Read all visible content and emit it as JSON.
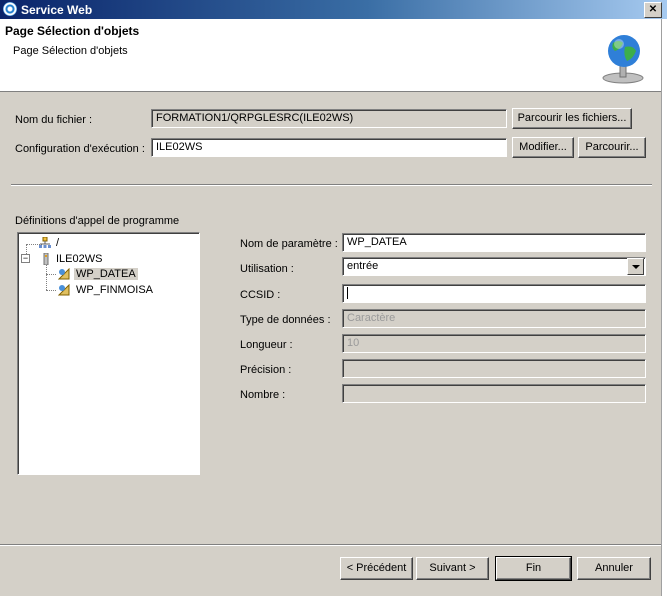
{
  "window": {
    "title": "Service Web"
  },
  "header": {
    "title": "Page Sélection d'objets",
    "subtitle": "Page Sélection d'objets"
  },
  "file": {
    "label": "Nom du fichier :",
    "value": "FORMATION1/QRPGLESRC(ILE02WS)",
    "browse_label": "Parcourir les fichiers..."
  },
  "config": {
    "label": "Configuration d'exécution :",
    "value": "ILE02WS",
    "modify_label": "Modifier...",
    "browse_label": "Parcourir..."
  },
  "tree": {
    "label": "Définitions d'appel de programme",
    "items": [
      {
        "label": "/"
      },
      {
        "label": "ILE02WS"
      },
      {
        "label": "WP_DATEA"
      },
      {
        "label": "WP_FINMOISA"
      }
    ]
  },
  "params": {
    "name_label": "Nom de paramètre :",
    "name_value": "WP_DATEA",
    "usage_label": "Utilisation :",
    "usage_value": "entrée",
    "ccsid_label": "CCSID :",
    "ccsid_value": "",
    "type_label": "Type de données :",
    "type_value": "Caractère",
    "length_label": "Longueur :",
    "length_value": "10",
    "precision_label": "Précision :",
    "precision_value": "",
    "count_label": "Nombre :",
    "count_value": ""
  },
  "footer": {
    "back_label": "< Précédent",
    "next_label": "Suivant >",
    "finish_label": "Fin",
    "cancel_label": "Annuler"
  }
}
